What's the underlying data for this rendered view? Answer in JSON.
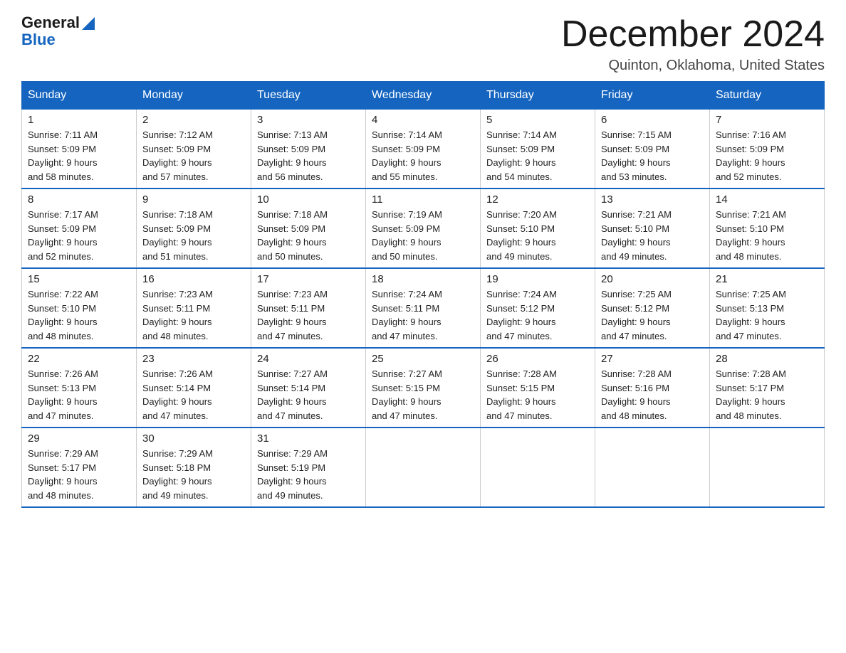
{
  "logo": {
    "line1": "General",
    "line2": "Blue"
  },
  "header": {
    "title": "December 2024",
    "location": "Quinton, Oklahoma, United States"
  },
  "weekdays": [
    "Sunday",
    "Monday",
    "Tuesday",
    "Wednesday",
    "Thursday",
    "Friday",
    "Saturday"
  ],
  "weeks": [
    [
      {
        "day": "1",
        "sunrise": "7:11 AM",
        "sunset": "5:09 PM",
        "daylight": "9 hours and 58 minutes."
      },
      {
        "day": "2",
        "sunrise": "7:12 AM",
        "sunset": "5:09 PM",
        "daylight": "9 hours and 57 minutes."
      },
      {
        "day": "3",
        "sunrise": "7:13 AM",
        "sunset": "5:09 PM",
        "daylight": "9 hours and 56 minutes."
      },
      {
        "day": "4",
        "sunrise": "7:14 AM",
        "sunset": "5:09 PM",
        "daylight": "9 hours and 55 minutes."
      },
      {
        "day": "5",
        "sunrise": "7:14 AM",
        "sunset": "5:09 PM",
        "daylight": "9 hours and 54 minutes."
      },
      {
        "day": "6",
        "sunrise": "7:15 AM",
        "sunset": "5:09 PM",
        "daylight": "9 hours and 53 minutes."
      },
      {
        "day": "7",
        "sunrise": "7:16 AM",
        "sunset": "5:09 PM",
        "daylight": "9 hours and 52 minutes."
      }
    ],
    [
      {
        "day": "8",
        "sunrise": "7:17 AM",
        "sunset": "5:09 PM",
        "daylight": "9 hours and 52 minutes."
      },
      {
        "day": "9",
        "sunrise": "7:18 AM",
        "sunset": "5:09 PM",
        "daylight": "9 hours and 51 minutes."
      },
      {
        "day": "10",
        "sunrise": "7:18 AM",
        "sunset": "5:09 PM",
        "daylight": "9 hours and 50 minutes."
      },
      {
        "day": "11",
        "sunrise": "7:19 AM",
        "sunset": "5:09 PM",
        "daylight": "9 hours and 50 minutes."
      },
      {
        "day": "12",
        "sunrise": "7:20 AM",
        "sunset": "5:10 PM",
        "daylight": "9 hours and 49 minutes."
      },
      {
        "day": "13",
        "sunrise": "7:21 AM",
        "sunset": "5:10 PM",
        "daylight": "9 hours and 49 minutes."
      },
      {
        "day": "14",
        "sunrise": "7:21 AM",
        "sunset": "5:10 PM",
        "daylight": "9 hours and 48 minutes."
      }
    ],
    [
      {
        "day": "15",
        "sunrise": "7:22 AM",
        "sunset": "5:10 PM",
        "daylight": "9 hours and 48 minutes."
      },
      {
        "day": "16",
        "sunrise": "7:23 AM",
        "sunset": "5:11 PM",
        "daylight": "9 hours and 48 minutes."
      },
      {
        "day": "17",
        "sunrise": "7:23 AM",
        "sunset": "5:11 PM",
        "daylight": "9 hours and 47 minutes."
      },
      {
        "day": "18",
        "sunrise": "7:24 AM",
        "sunset": "5:11 PM",
        "daylight": "9 hours and 47 minutes."
      },
      {
        "day": "19",
        "sunrise": "7:24 AM",
        "sunset": "5:12 PM",
        "daylight": "9 hours and 47 minutes."
      },
      {
        "day": "20",
        "sunrise": "7:25 AM",
        "sunset": "5:12 PM",
        "daylight": "9 hours and 47 minutes."
      },
      {
        "day": "21",
        "sunrise": "7:25 AM",
        "sunset": "5:13 PM",
        "daylight": "9 hours and 47 minutes."
      }
    ],
    [
      {
        "day": "22",
        "sunrise": "7:26 AM",
        "sunset": "5:13 PM",
        "daylight": "9 hours and 47 minutes."
      },
      {
        "day": "23",
        "sunrise": "7:26 AM",
        "sunset": "5:14 PM",
        "daylight": "9 hours and 47 minutes."
      },
      {
        "day": "24",
        "sunrise": "7:27 AM",
        "sunset": "5:14 PM",
        "daylight": "9 hours and 47 minutes."
      },
      {
        "day": "25",
        "sunrise": "7:27 AM",
        "sunset": "5:15 PM",
        "daylight": "9 hours and 47 minutes."
      },
      {
        "day": "26",
        "sunrise": "7:28 AM",
        "sunset": "5:15 PM",
        "daylight": "9 hours and 47 minutes."
      },
      {
        "day": "27",
        "sunrise": "7:28 AM",
        "sunset": "5:16 PM",
        "daylight": "9 hours and 48 minutes."
      },
      {
        "day": "28",
        "sunrise": "7:28 AM",
        "sunset": "5:17 PM",
        "daylight": "9 hours and 48 minutes."
      }
    ],
    [
      {
        "day": "29",
        "sunrise": "7:29 AM",
        "sunset": "5:17 PM",
        "daylight": "9 hours and 48 minutes."
      },
      {
        "day": "30",
        "sunrise": "7:29 AM",
        "sunset": "5:18 PM",
        "daylight": "9 hours and 49 minutes."
      },
      {
        "day": "31",
        "sunrise": "7:29 AM",
        "sunset": "5:19 PM",
        "daylight": "9 hours and 49 minutes."
      },
      null,
      null,
      null,
      null
    ]
  ],
  "labels": {
    "sunrise": "Sunrise:",
    "sunset": "Sunset:",
    "daylight": "Daylight:"
  }
}
